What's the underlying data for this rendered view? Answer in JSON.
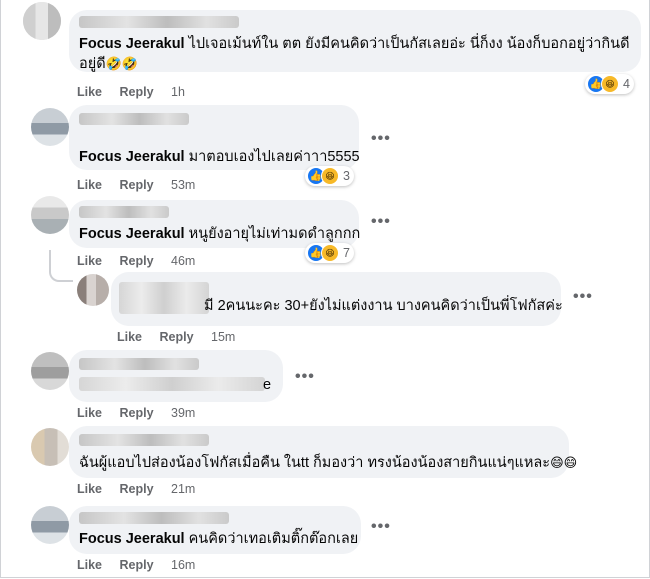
{
  "comments": [
    {
      "tag": "Focus Jeerakul",
      "text1": "ไปเจอเม้นท์ใน ตต ยังมีคนคิดว่าเป็นกัสเลยอ่ะ นี่ก็งง น้องก็บอกอยู่ว่ากินดี",
      "text2": "อยู่ดี",
      "emoji": "🤣🤣",
      "like": "Like",
      "reply": "Reply",
      "time": "1h",
      "reaction_count": "4"
    },
    {
      "tag": "Focus Jeerakul",
      "text1": "มาตอบเองไปเลยค่าาา5555",
      "like": "Like",
      "reply": "Reply",
      "time": "53m",
      "reaction_count": "3"
    },
    {
      "tag": "Focus Jeerakul",
      "text1": "หนูยังอายุไม่เท่ามดดำลูกกก",
      "like": "Like",
      "reply": "Reply",
      "time": "46m",
      "reaction_count": "7"
    },
    {
      "text1": "มี 2คนนะคะ 30+ยังไม่แต่งงาน บางคนคิดว่าเป็นพี่โฟกัสค่ะ",
      "like": "Like",
      "reply": "Reply",
      "time": "15m"
    },
    {
      "text1": "e",
      "like": "Like",
      "reply": "Reply",
      "time": "39m"
    },
    {
      "text1": "ฉันผู้แอบไปส่องน้องโฟกัสเมื่อคืน ในtt ก็มองว่า ทรงน้องน้องสายกินแน่ๆแหละ",
      "emoji": "😄😄",
      "like": "Like",
      "reply": "Reply",
      "time": "21m"
    },
    {
      "tag": "Focus Jeerakul",
      "text1": "คนคิดว่าเทอเติมติ๊กต๊อกเลย",
      "like": "Like",
      "reply": "Reply",
      "time": "16m"
    }
  ],
  "icons": {
    "like_icon": "👍",
    "haha_icon": "😆",
    "more_icon": "•••"
  },
  "colors": {
    "bubble": "#f0f2f5",
    "like_blue": "#1877f2",
    "haha_yellow": "#f7b928",
    "meta_gray": "#65676b"
  }
}
